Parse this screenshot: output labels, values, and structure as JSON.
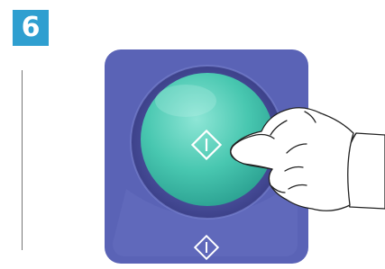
{
  "step": {
    "number": "6"
  },
  "colors": {
    "badge": "#2f9fd0",
    "panel": "#5a63b6",
    "button": "#3ebfa7",
    "icon": "#ffffff"
  },
  "icons": {
    "start_icon_on_button": "start-diamond-icon",
    "start_icon_on_panel": "start-diamond-icon"
  }
}
